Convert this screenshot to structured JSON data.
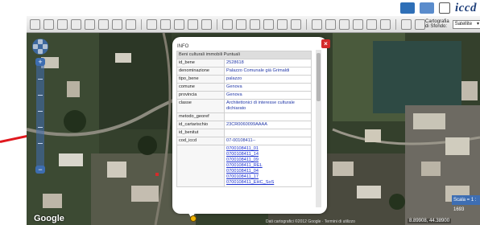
{
  "toolbar": {
    "basemap_label": "Cartografia di Sfondo:",
    "basemap_value": "Satellite"
  },
  "brand": {
    "logo_text": "iccd"
  },
  "popup": {
    "title": "INFO",
    "section_header": "Beni culturali immobili Puntuali",
    "rows": [
      {
        "key": "id_bene",
        "value": "2528618"
      },
      {
        "key": "denominazione",
        "value": "Palazzo Comunale già Grimaldi"
      },
      {
        "key": "tipo_bene",
        "value": "palazzo"
      },
      {
        "key": "comune",
        "value": "Genova"
      },
      {
        "key": "provincia",
        "value": "Genova"
      },
      {
        "key": "classe",
        "value": "Architettonici di interesse culturale dichiarato"
      },
      {
        "key": "metodo_georef",
        "value": ""
      },
      {
        "key": "id_cartarischio",
        "value": "23CR0060099AAAA"
      },
      {
        "key": "id_benitut",
        "value": ""
      },
      {
        "key": "cod_iccd",
        "value": "07-00108411--"
      }
    ],
    "codes": [
      "0700108411_01",
      "0700108411_14",
      "0700108411_09",
      "0700108411_REL",
      "0700108411_04",
      "0700108411_17",
      "0700108411_EHC_SoS"
    ],
    "close_symbol": "×"
  },
  "map": {
    "attribution": "Google",
    "attribution_small": "Dati cartografici ©2012 Google · Termini di utilizzo",
    "scale_text": "Scala = 1 : 1693",
    "coordinates": "8.89908, 44.38900"
  },
  "nav": {
    "zoom_in": "+",
    "zoom_out": "−"
  },
  "colors": {
    "accent": "#3d6db0",
    "close": "#d42b2b",
    "arrow": "#e0181e"
  }
}
